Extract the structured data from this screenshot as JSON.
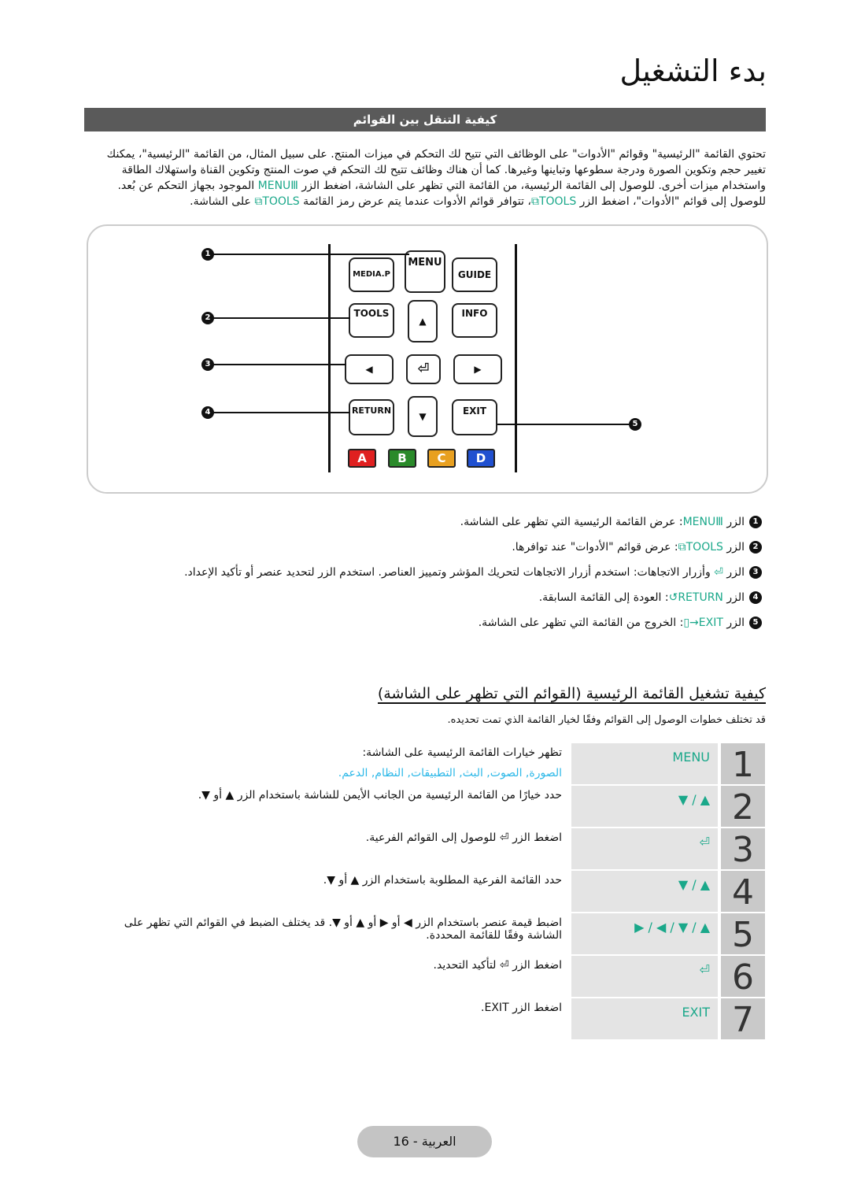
{
  "header": {
    "title": "بدء التشغيل",
    "section_bar": "كيفية التنقل بين القوائم"
  },
  "intro": {
    "p1": "تحتوي القائمة \"الرئيسية\" وقوائم \"الأدوات\" على الوظائف التي تتيح لك التحكم في ميزات المنتج. على سبيل المثال، من القائمة \"الرئيسية\"، يمكنك تغيير حجم وتكوين الصورة ودرجة سطوعها وتباينها وغيرها. كما أن هناك وظائف تتيح لك التحكم في صوت المنتج وتكوين القناة واستهلاك الطاقة واستخدام ميزات أخرى. للوصول إلى القائمة الرئيسية، من القائمة التي تظهر على الشاشة، اضغط الزر",
    "menu_key": "MENU",
    "p2": "الموجود بجهاز التحكم عن بُعد. للوصول إلى قوائم \"الأدوات\"، اضغط الزر",
    "tools_key": "TOOLS",
    "p3": "، تتوافر قوائم الأدوات عندما يتم عرض رمز القائمة",
    "p4": "على الشاشة."
  },
  "remote": {
    "buttons": [
      "MEDIA.P",
      "MENU",
      "GUIDE",
      "TOOLS",
      "INFO",
      "RETURN",
      "EXIT"
    ],
    "color_buttons": [
      {
        "label": "A",
        "color": "#e02020"
      },
      {
        "label": "B",
        "color": "#2a8a2a"
      },
      {
        "label": "C",
        "color": "#e8a020"
      },
      {
        "label": "D",
        "color": "#2050d0"
      }
    ],
    "callouts": [
      "1",
      "2",
      "3",
      "4",
      "5"
    ]
  },
  "legend": [
    {
      "n": "1",
      "pre": "الزر",
      "key": "MENU",
      "text": ": عرض القائمة الرئيسية التي تظهر على الشاشة."
    },
    {
      "n": "2",
      "pre": "الزر",
      "key": "TOOLS",
      "text": ": عرض قوائم \"الأدوات\" عند توافرها."
    },
    {
      "n": "3",
      "pre": "الزر",
      "key": "",
      "text": "وأزرار الاتجاهات: استخدم أزرار الاتجاهات لتحريك المؤشر وتمييز العناصر. استخدم الزر لتحديد عنصر أو تأكيد الإعداد."
    },
    {
      "n": "4",
      "pre": "الزر",
      "key": "RETURN",
      "text": ": العودة إلى القائمة السابقة."
    },
    {
      "n": "5",
      "pre": "الزر",
      "key": "EXIT",
      "text": ": الخروج من القائمة التي تظهر على الشاشة."
    }
  ],
  "howto": {
    "title": "كيفية تشغيل القائمة الرئيسية (القوائم التي تظهر على الشاشة)",
    "subtitle": "قد تختلف خطوات الوصول إلى القوائم وفقًا لخيار القائمة الذي تمت تحديده.",
    "steps": [
      {
        "n": "1",
        "key": "MENU",
        "desc": "تظهر خيارات القائمة الرئيسية على الشاشة:",
        "links": "الصورة, الصوت, البث, التطبيقات, النظام, الدعم."
      },
      {
        "n": "2",
        "key": "▲ / ▼",
        "desc": "حدد خيارًا من القائمة الرئيسية من الجانب الأيمن للشاشة باستخدام الزر ▲ أو ▼."
      },
      {
        "n": "3",
        "key": "⏎",
        "desc": "اضغط الزر ⏎ للوصول إلى القوائم الفرعية."
      },
      {
        "n": "4",
        "key": "▲ / ▼",
        "desc": "حدد القائمة الفرعية المطلوبة باستخدام الزر ▲ أو ▼."
      },
      {
        "n": "5",
        "key": "▲ / ▼ / ◀ / ▶",
        "desc": "اضبط قيمة عنصر باستخدام الزر ◀ أو ▶ أو ▲ أو ▼. قد يختلف الضبط في القوائم التي تظهر على الشاشة وفقًا للقائمة المحددة."
      },
      {
        "n": "6",
        "key": "⏎",
        "desc": "اضغط الزر ⏎ لتأكيد التحديد."
      },
      {
        "n": "7",
        "key": "EXIT",
        "desc": "اضغط الزر EXIT."
      }
    ]
  },
  "footer": {
    "page": "العربية - 16"
  },
  "colors": {
    "accent": "#1aa88a",
    "link": "#2cb8e8",
    "bar": "#5a5a5a"
  }
}
